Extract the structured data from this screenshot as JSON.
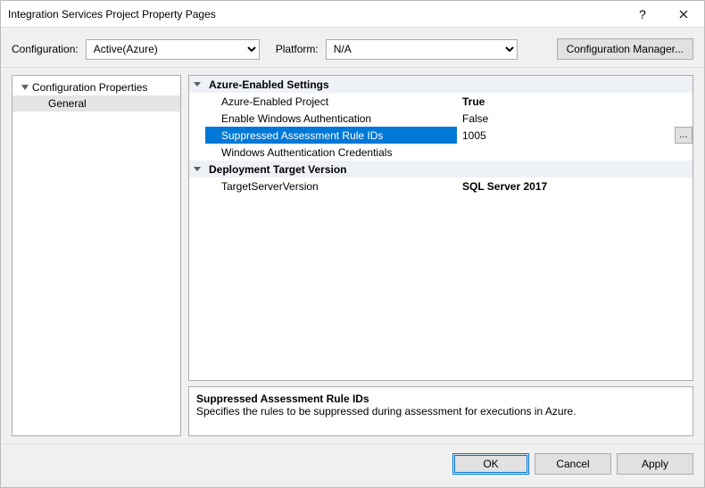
{
  "title": "Integration Services Project Property Pages",
  "configLabel": "Configuration:",
  "configValue": "Active(Azure)",
  "platformLabel": "Platform:",
  "platformValue": "N/A",
  "configManager": "Configuration Manager...",
  "tree": {
    "root": "Configuration Properties",
    "child": "General"
  },
  "grid": {
    "cat1": "Azure-Enabled Settings",
    "rows1": [
      {
        "name": "Azure-Enabled Project",
        "value": "True",
        "bold": true
      },
      {
        "name": "Enable Windows Authentication",
        "value": "False",
        "bold": false
      },
      {
        "name": "Suppressed Assessment Rule IDs",
        "value": "1005",
        "bold": false,
        "selected": true,
        "ellipsis": true
      },
      {
        "name": "Windows Authentication Credentials",
        "value": "",
        "bold": false
      }
    ],
    "cat2": "Deployment Target Version",
    "rows2": [
      {
        "name": "TargetServerVersion",
        "value": "SQL Server 2017",
        "bold": true
      }
    ]
  },
  "desc": {
    "title": "Suppressed Assessment Rule IDs",
    "text": "Specifies the rules to be suppressed during assessment for executions in Azure."
  },
  "buttons": {
    "ok": "OK",
    "cancel": "Cancel",
    "apply": "Apply"
  }
}
